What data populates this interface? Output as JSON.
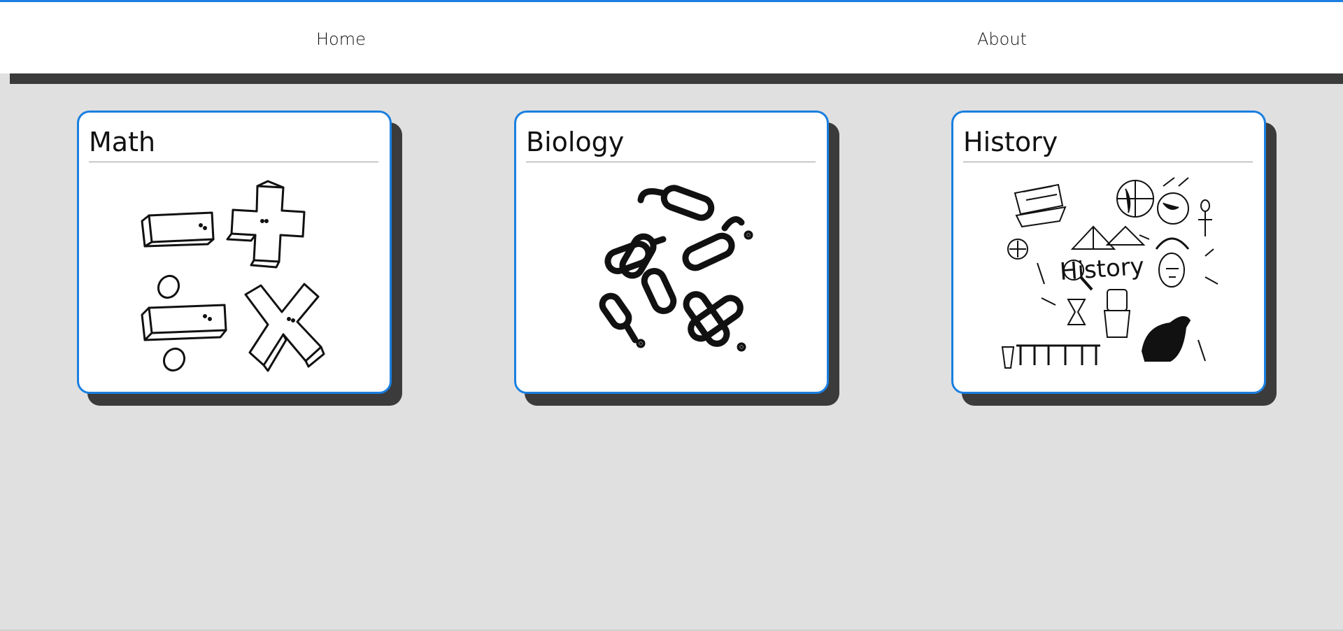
{
  "nav": {
    "home_label": "Home",
    "about_label": "About"
  },
  "colors": {
    "accent": "#1a7fe0",
    "background": "#e0e0e0",
    "shadow": "#3b3b3b"
  },
  "cards": [
    {
      "title": "Math",
      "image_icon": "math-operators-icon"
    },
    {
      "title": "Biology",
      "image_icon": "bacteria-icon"
    },
    {
      "title": "History",
      "image_icon": "history-doodles-icon",
      "image_text": "History"
    }
  ]
}
